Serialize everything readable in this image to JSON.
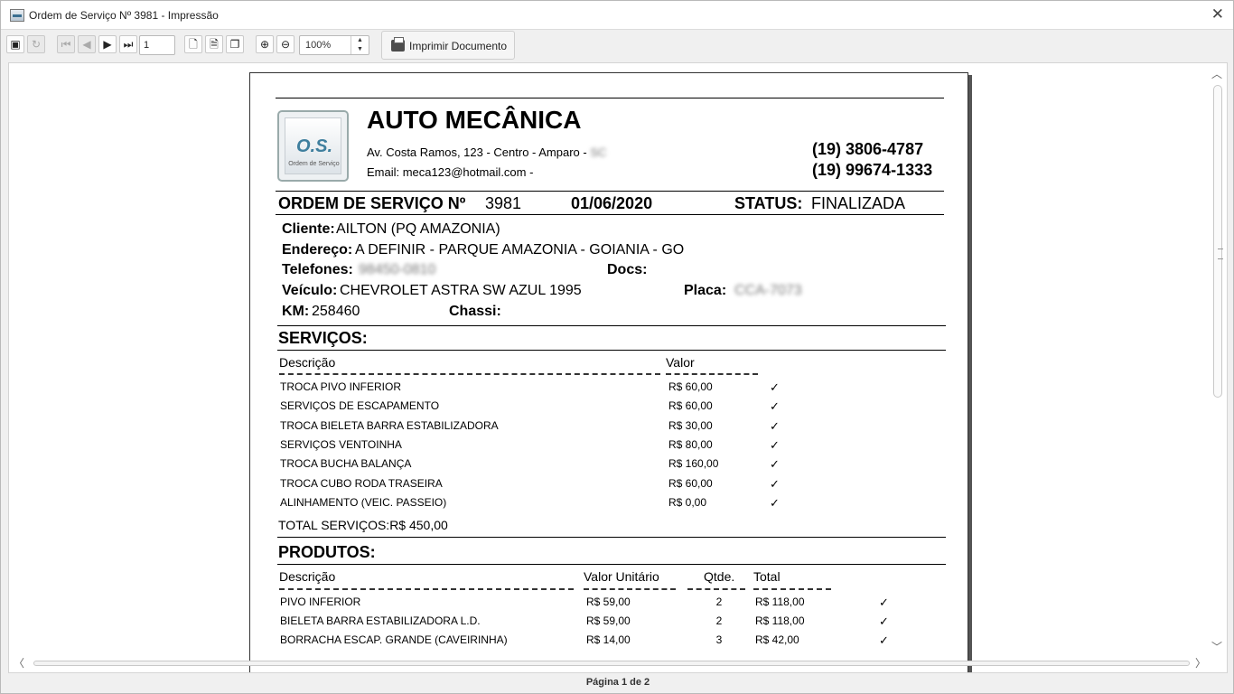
{
  "window": {
    "title": "Ordem de Serviço Nº 3981 - Impressão",
    "close": "✕"
  },
  "toolbar": {
    "page_input": "1",
    "zoom": "100%",
    "print_label": "Imprimir Documento",
    "icons": {
      "save": "save-icon",
      "refresh": "refresh-icon",
      "first": "first-page-icon",
      "prev": "prev-page-icon",
      "next": "next-page-icon",
      "last": "last-page-icon",
      "zoom_in": "zoom-in-icon",
      "zoom_out": "zoom-out-icon"
    }
  },
  "header": {
    "company": "AUTO MECÂNICA",
    "address": "Av. Costa Ramos, 123 - Centro - Amparo -",
    "address_blurred": "SC",
    "email": "Email: meca123@hotmail.com -",
    "phone1": "(19) 3806-4787",
    "phone2": "(19) 99674-1333",
    "logo_text": "O.S.",
    "logo_caption": "Ordem de Serviço"
  },
  "os": {
    "label": "ORDEM DE SERVIÇO Nº",
    "number": "3981",
    "date": "01/06/2020",
    "status_label": "STATUS:",
    "status": "FINALIZADA"
  },
  "client": {
    "cliente_label": "Cliente:",
    "cliente": "AILTON (PQ AMAZONIA)",
    "endereco_label": "Endereço:",
    "endereco": "A DEFINIR - PARQUE AMAZONIA - GOIANIA - GO",
    "telefones_label": "Telefones:",
    "telefones_blurred": "98450-0810",
    "docs_label": "Docs:",
    "veiculo_label": "Veículo:",
    "veiculo": "CHEVROLET ASTRA SW AZUL 1995",
    "placa_label": "Placa:",
    "placa_blurred": "CCA-7073",
    "km_label": "KM:",
    "km": "258460",
    "chassi_label": "Chassi:"
  },
  "servicos": {
    "title": "SERVIÇOS:",
    "col_desc": "Descrição",
    "col_valor": "Valor",
    "items": [
      {
        "desc": "TROCA PIVO INFERIOR",
        "valor": "R$ 60,00",
        "check": "✓"
      },
      {
        "desc": "SERVIÇOS DE ESCAPAMENTO",
        "valor": "R$ 60,00",
        "check": "✓"
      },
      {
        "desc": "TROCA BIELETA BARRA ESTABILIZADORA",
        "valor": "R$ 30,00",
        "check": "✓"
      },
      {
        "desc": "SERVIÇOS VENTOINHA",
        "valor": "R$ 80,00",
        "check": "✓"
      },
      {
        "desc": "TROCA BUCHA BALANÇA",
        "valor": "R$ 160,00",
        "check": "✓"
      },
      {
        "desc": "TROCA CUBO RODA TRASEIRA",
        "valor": "R$ 60,00",
        "check": "✓"
      },
      {
        "desc": "ALINHAMENTO (VEIC. PASSEIO)",
        "valor": "R$ 0,00",
        "check": "✓"
      }
    ],
    "total_label": "TOTAL SERVIÇOS:",
    "total": "R$  450,00"
  },
  "produtos": {
    "title": "PRODUTOS:",
    "col_desc": "Descrição",
    "col_unit": "Valor Unitário",
    "col_qtd": "Qtde.",
    "col_total": "Total",
    "items": [
      {
        "desc": "PIVO INFERIOR",
        "unit": "R$ 59,00",
        "qtd": "2",
        "total": "R$ 118,00",
        "check": "✓"
      },
      {
        "desc": "BIELETA BARRA ESTABILIZADORA L.D.",
        "unit": "R$ 59,00",
        "qtd": "2",
        "total": "R$ 118,00",
        "check": "✓"
      },
      {
        "desc": "BORRACHA ESCAP.  GRANDE (CAVEIRINHA)",
        "unit": "R$ 14,00",
        "qtd": "3",
        "total": "R$ 42,00",
        "check": "✓"
      }
    ]
  },
  "footer": {
    "page_info": "Página 1 de 2"
  }
}
